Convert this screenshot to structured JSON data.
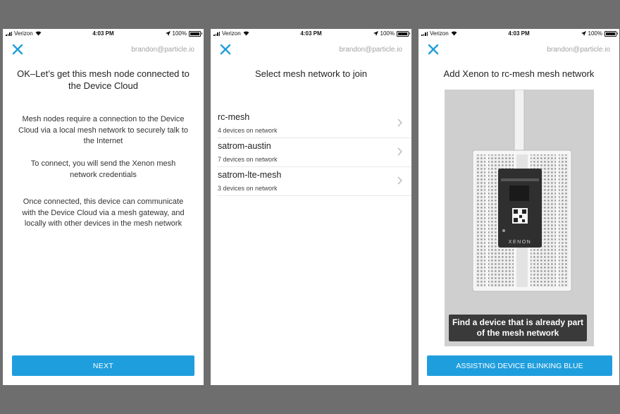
{
  "status_bar": {
    "carrier": "Verizon",
    "time": "4:03 PM",
    "battery": "100%"
  },
  "account": "brandon@particle.io",
  "screen1": {
    "title": "OK–Let’s get this mesh node connected to the Device Cloud",
    "paragraphs": [
      "Mesh nodes require a connection to the Device Cloud via a local mesh network to securely talk to the Internet",
      "To connect, you will send the Xenon mesh network credentials",
      "Once connected, this device can communicate with the Device Cloud via a mesh gateway, and locally with other devices in the mesh network"
    ],
    "button": "NEXT"
  },
  "screen2": {
    "title": "Select mesh network to join",
    "networks": [
      {
        "name": "rc-mesh",
        "meta": "4 devices on network"
      },
      {
        "name": "satrom-austin",
        "meta": "7 devices on network"
      },
      {
        "name": "satrom-lte-mesh",
        "meta": "3 devices on network"
      }
    ]
  },
  "screen3": {
    "title": "Add Xenon to rc-mesh mesh network",
    "caption": "Find a device that is already part of the mesh network",
    "board_label": "XENON",
    "button": "ASSISTING DEVICE BLINKING BLUE"
  },
  "colors": {
    "accent": "#1f9ede",
    "background": "#6e6e6e"
  }
}
